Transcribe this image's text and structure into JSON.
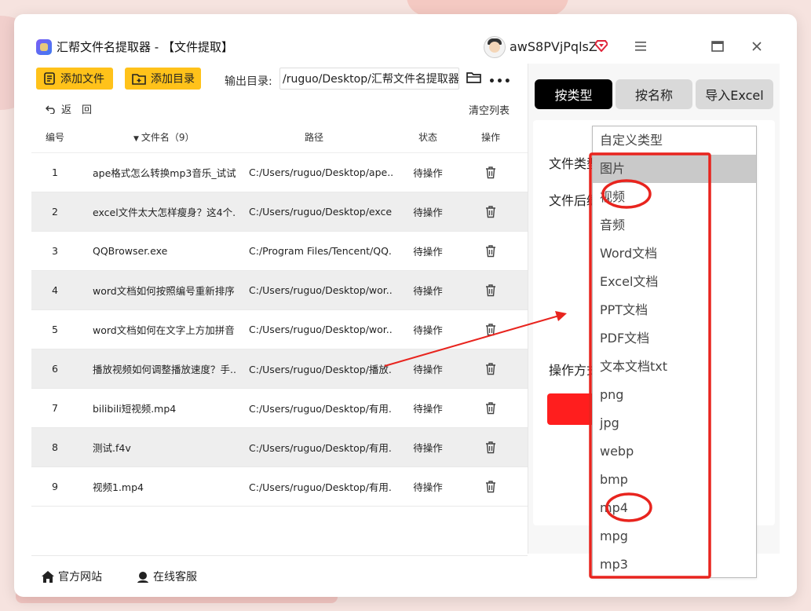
{
  "window": {
    "title": "汇帮文件名提取器 - 【文件提取】",
    "username": "awS8PVjPqlsZ"
  },
  "toolbar": {
    "add_file_label": "添加文件",
    "add_dir_label": "添加目录",
    "output_dir_label": "输出目录:",
    "output_dir_value": "/ruguo/Desktop/汇帮文件名提取器",
    "more_label": "•••"
  },
  "list_actions": {
    "back_label": "返　回",
    "clear_label": "清空列表"
  },
  "table": {
    "headers": {
      "no": "编号",
      "name": "文件名（9）",
      "path": "路径",
      "state": "状态",
      "op": "操作"
    },
    "rows": [
      {
        "no": "1",
        "name": "ape格式怎么转换mp3音乐_试试...",
        "path": "C:/Users/ruguo/Desktop/ape...",
        "state": "待操作"
      },
      {
        "no": "2",
        "name": "excel文件太大怎样瘦身？这4个...",
        "path": "C:/Users/ruguo/Desktop/excel...",
        "state": "待操作"
      },
      {
        "no": "3",
        "name": "QQBrowser.exe",
        "path": "C:/Program Files/Tencent/QQ...",
        "state": "待操作"
      },
      {
        "no": "4",
        "name": "word文档如何按照编号重新排序...",
        "path": "C:/Users/ruguo/Desktop/wor...",
        "state": "待操作"
      },
      {
        "no": "5",
        "name": "word文档如何在文字上方加拼音...",
        "path": "C:/Users/ruguo/Desktop/wor...",
        "state": "待操作"
      },
      {
        "no": "6",
        "name": "播放视频如何调整播放速度？手...",
        "path": "C:/Users/ruguo/Desktop/播放...",
        "state": "待操作"
      },
      {
        "no": "7",
        "name": "bilibili短视频.mp4",
        "path": "C:/Users/ruguo/Desktop/有用...",
        "state": "待操作"
      },
      {
        "no": "8",
        "name": "测试.f4v",
        "path": "C:/Users/ruguo/Desktop/有用...",
        "state": "待操作"
      },
      {
        "no": "9",
        "name": "视频1.mp4",
        "path": "C:/Users/ruguo/Desktop/有用...",
        "state": "待操作"
      }
    ]
  },
  "footer": {
    "website_label": "官方网站",
    "support_label": "在线客服"
  },
  "panel": {
    "tabs": [
      "按类型",
      "按名称",
      "导入Excel"
    ],
    "file_type_label": "文件类型",
    "file_suffix_label": "文件后缀",
    "op_mode_label": "操作方式"
  },
  "dropdown": {
    "options": [
      "自定义类型",
      "图片",
      "视频",
      "音频",
      "Word文档",
      "Excel文档",
      "PPT文档",
      "PDF文档",
      "文本文档txt",
      "png",
      "jpg",
      "webp",
      "bmp",
      "mp4",
      "mpg",
      "mp3"
    ],
    "highlighted": "图片"
  },
  "colors": {
    "accent_yellow": "#ffc21a",
    "tab_active": "#000000",
    "annotation_red": "#e8241e",
    "action_red": "#ff1e1e"
  }
}
